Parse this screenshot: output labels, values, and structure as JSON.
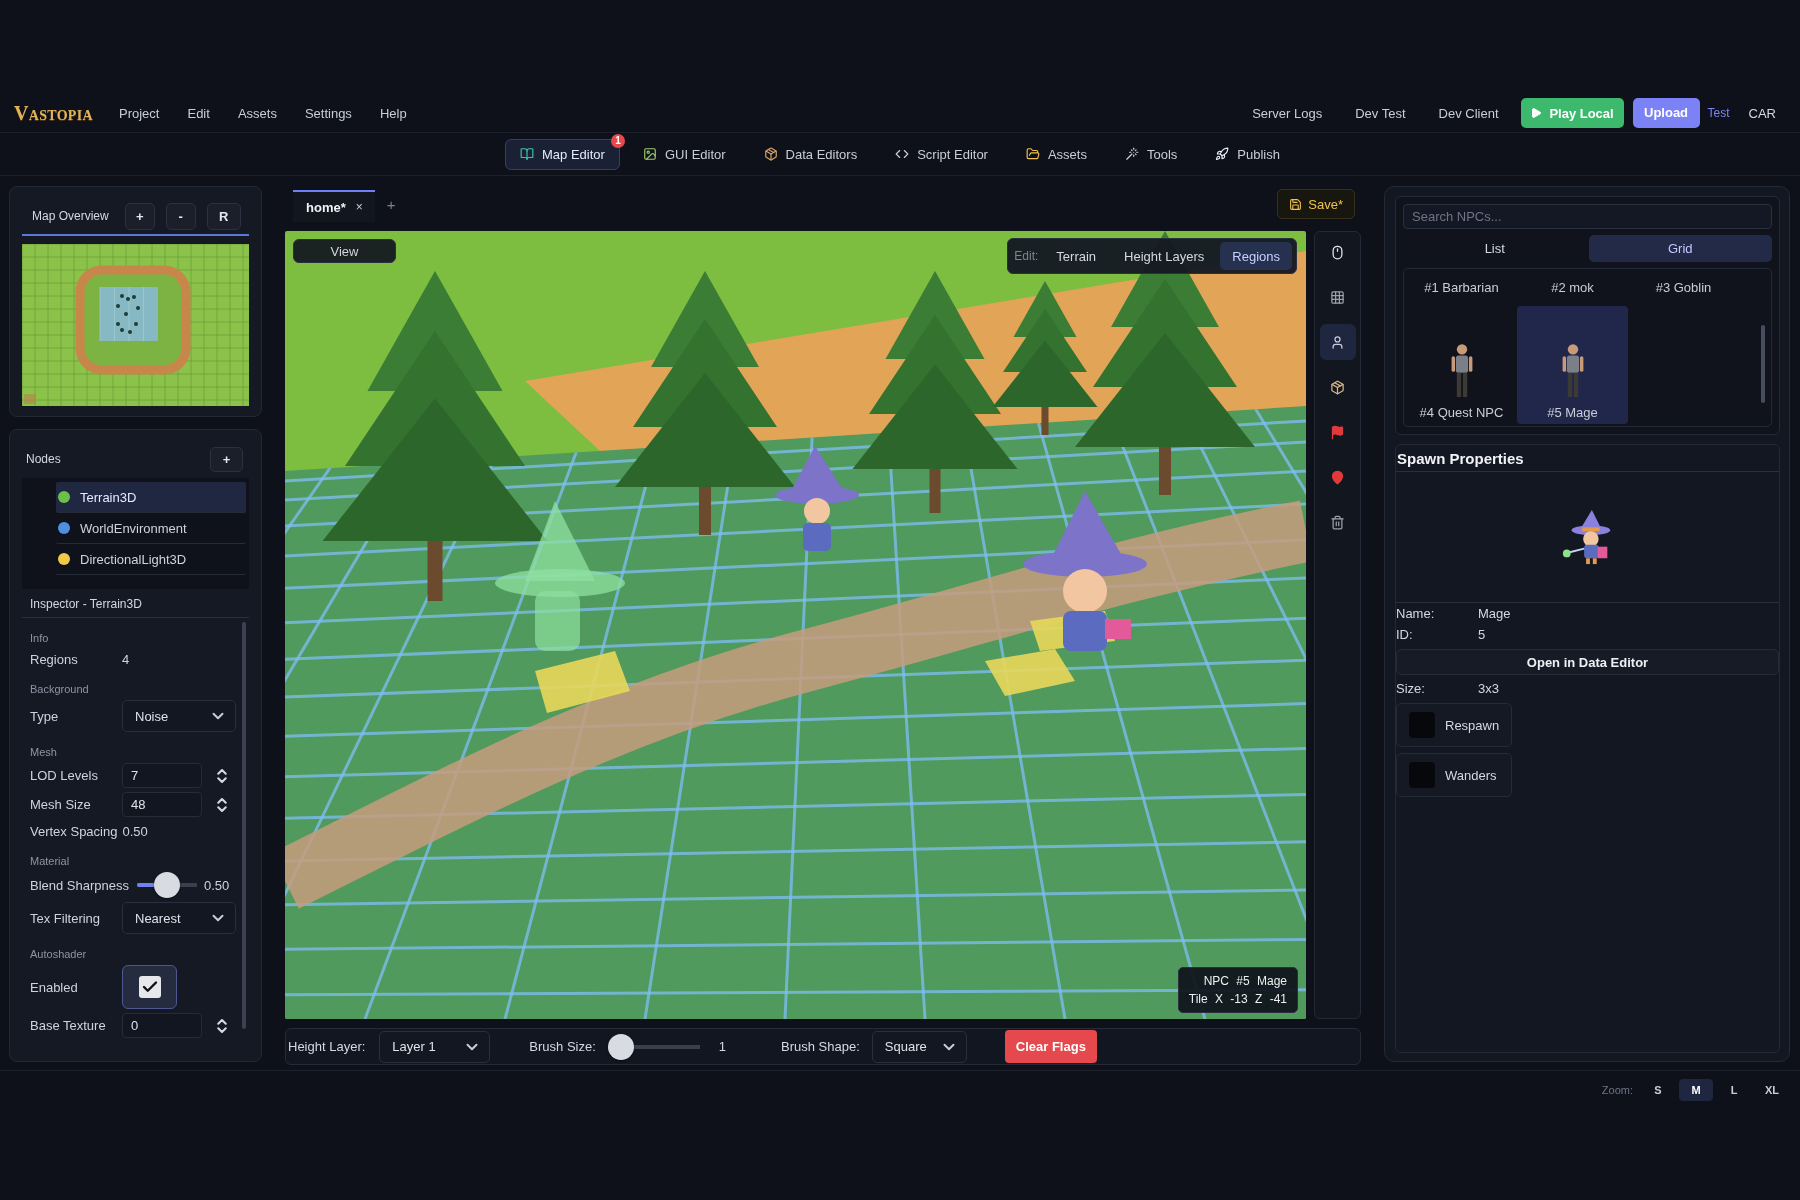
{
  "menubar": {
    "logo": "VASTOPIA",
    "menus": [
      "Project",
      "Edit",
      "Assets",
      "Settings",
      "Help"
    ],
    "links": [
      "Server Logs",
      "Dev Test",
      "Dev Client"
    ],
    "play_button": "Play Local",
    "upload_button": "Upload",
    "test_link": "Test",
    "user": "CAR"
  },
  "editor_tabs": [
    {
      "label": "Map Editor",
      "kind": "map",
      "selected": true,
      "badge": "1"
    },
    {
      "label": "GUI Editor",
      "kind": "gui",
      "selected": false
    },
    {
      "label": "Data Editors",
      "kind": "data",
      "selected": false
    },
    {
      "label": "Script Editor",
      "kind": "script",
      "selected": false
    },
    {
      "label": "Assets",
      "kind": "assets",
      "selected": false
    },
    {
      "label": "Tools",
      "kind": "tools",
      "selected": false
    },
    {
      "label": "Publish",
      "kind": "publish",
      "selected": false
    }
  ],
  "map_overview": {
    "title": "Map Overview",
    "buttons": [
      "+",
      "-",
      "R"
    ]
  },
  "nodes": {
    "title": "Nodes",
    "add_button": "+",
    "items": [
      {
        "label": "Terrain3D",
        "color": "#6cc04a",
        "selected": true
      },
      {
        "label": "WorldEnvironment",
        "color": "#4f8fe0",
        "selected": false
      },
      {
        "label": "DirectionalLight3D",
        "color": "#f0c84a",
        "selected": false
      }
    ]
  },
  "inspector": {
    "title": "Inspector - Terrain3D",
    "sections": [
      {
        "heading": "Info",
        "rows": [
          {
            "kind": "text",
            "label": "Regions",
            "value": "4"
          }
        ]
      },
      {
        "heading": "Background",
        "rows": [
          {
            "kind": "dropdown",
            "label": "Type",
            "value": "Noise"
          }
        ]
      },
      {
        "heading": "Mesh",
        "rows": [
          {
            "kind": "number",
            "label": "LOD Levels",
            "value": "7"
          },
          {
            "kind": "number",
            "label": "Mesh Size",
            "value": "48"
          },
          {
            "kind": "text",
            "label": "Vertex Spacing",
            "value": "0.50"
          }
        ]
      },
      {
        "heading": "Material",
        "rows": [
          {
            "kind": "slider",
            "label": "Blend Sharpness",
            "level": 0.5,
            "value": "0.50"
          },
          {
            "kind": "dropdown",
            "label": "Tex Filtering",
            "value": "Nearest"
          }
        ]
      },
      {
        "heading": "Autoshader",
        "rows": [
          {
            "kind": "checkbox",
            "label": "Enabled",
            "checked": true
          },
          {
            "kind": "number",
            "label": "Base Texture",
            "value": "0"
          }
        ]
      }
    ]
  },
  "document_tabs": {
    "tabs": [
      {
        "label": "home*",
        "close": "×",
        "selected": true
      }
    ],
    "add_button": "+",
    "save_button": "Save*"
  },
  "viewport": {
    "view_button": "View",
    "edit_bar": {
      "label": "Edit:",
      "modes": [
        {
          "label": "Terrain",
          "selected": false
        },
        {
          "label": "Height Layers",
          "selected": false
        },
        {
          "label": "Regions",
          "selected": true
        }
      ]
    },
    "hover_info": [
      "NPC #5 Mage",
      "Tile X -13 Z -41"
    ]
  },
  "tool_rail": [
    {
      "kind": "pointer",
      "selected": false
    },
    {
      "kind": "tiles",
      "selected": false
    },
    {
      "kind": "npc",
      "selected": true
    },
    {
      "kind": "object",
      "selected": false
    },
    {
      "kind": "flag",
      "selected": false
    },
    {
      "kind": "pin",
      "selected": false
    },
    {
      "kind": "delete",
      "selected": false
    }
  ],
  "brush_bar": {
    "height_layer_label": "Height Layer:",
    "height_layer": "Layer 1",
    "brush_size_label": "Brush Size:",
    "brush_size": {
      "level": 0,
      "value": "1"
    },
    "brush_shape_label": "Brush Shape:",
    "brush_shape": "Square",
    "clear_button": "Clear Flags"
  },
  "npc_browser": {
    "search": {
      "placeholder": "Search NPCs..."
    },
    "views": [
      {
        "label": "List",
        "selected": false
      },
      {
        "label": "Grid",
        "selected": true
      }
    ],
    "npcs": [
      {
        "label": "#1 Barbarian",
        "portrait": false,
        "selected": false
      },
      {
        "label": "#2 mok",
        "portrait": false,
        "selected": false
      },
      {
        "label": "#3 Goblin",
        "portrait": false,
        "selected": false
      },
      {
        "label": "#4 Quest NPC",
        "portrait": true,
        "selected": false
      },
      {
        "label": "#5 Mage",
        "portrait": true,
        "selected": true
      }
    ]
  },
  "spawn_properties": {
    "title": "Spawn Properties",
    "fields": [
      {
        "label": "Name:",
        "value": "Mage"
      },
      {
        "label": "ID:",
        "value": "5"
      }
    ],
    "open_button": "Open in Data Editor",
    "size": {
      "label": "Size:",
      "value": "3x3"
    },
    "toggles": [
      {
        "label": "Respawn",
        "checked": false
      },
      {
        "label": "Wanders",
        "checked": false
      }
    ]
  },
  "status_bar": {
    "zoom_label": "Zoom:",
    "zoom_options": [
      {
        "label": "S",
        "selected": false
      },
      {
        "label": "M",
        "selected": true
      },
      {
        "label": "L",
        "selected": false
      },
      {
        "label": "XL",
        "selected": false
      }
    ]
  }
}
